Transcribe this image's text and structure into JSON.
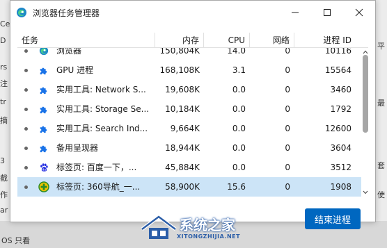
{
  "background": {
    "left_fragments": [
      "Ce",
      "D",
      "rs",
      "注",
      "tr",
      "摘",
      "3",
      "截",
      "作",
      "ar"
    ],
    "right_fragments": [
      "平",
      "最",
      "套",
      "使"
    ],
    "bottom_fragment": "OS 只看"
  },
  "window": {
    "title": "浏览器任务管理器",
    "controls": {
      "minimize": "minimize",
      "maximize": "maximize",
      "close": "close"
    }
  },
  "table": {
    "headers": {
      "task": "任务",
      "memory": "内存",
      "cpu": "CPU",
      "network": "网络",
      "pid": "进程 ID"
    },
    "rows": [
      {
        "icon": "edge-icon",
        "task": "浏览器",
        "memory": "150,804K",
        "cpu": "14.0",
        "network": "0",
        "pid": "10116",
        "selected": false
      },
      {
        "icon": "puzzle-icon",
        "task": "GPU 进程",
        "memory": "168,108K",
        "cpu": "3.1",
        "network": "0",
        "pid": "15564",
        "selected": false
      },
      {
        "icon": "puzzle-icon",
        "task": "实用工具: Network S...",
        "memory": "19,608K",
        "cpu": "0.0",
        "network": "0",
        "pid": "3460",
        "selected": false
      },
      {
        "icon": "puzzle-icon",
        "task": "实用工具: Storage Se...",
        "memory": "10,184K",
        "cpu": "0.0",
        "network": "0",
        "pid": "1792",
        "selected": false
      },
      {
        "icon": "puzzle-icon",
        "task": "实用工具: Search Ind...",
        "memory": "9,664K",
        "cpu": "0.0",
        "network": "0",
        "pid": "12600",
        "selected": false
      },
      {
        "icon": "puzzle-icon",
        "task": "备用呈现器",
        "memory": "18,944K",
        "cpu": "0.0",
        "network": "0",
        "pid": "3604",
        "selected": false
      },
      {
        "icon": "baidu-paw-icon",
        "task": "标签页: 百度一下，...",
        "memory": "45,884K",
        "cpu": "0.0",
        "network": "0",
        "pid": "3512",
        "selected": false
      },
      {
        "icon": "360-navigation-icon",
        "task": "标签页: 360导航_一...",
        "memory": "58,900K",
        "cpu": "15.6",
        "network": "0",
        "pid": "1908",
        "selected": true
      }
    ]
  },
  "actions": {
    "end_process": "结束进程"
  },
  "watermark": {
    "text": "系统之家",
    "sub": "XITONGZHIJIA.NET"
  },
  "colors": {
    "accent": "#0067c0",
    "selected_row": "#cce4f7",
    "puzzle": "#1a73e8"
  }
}
